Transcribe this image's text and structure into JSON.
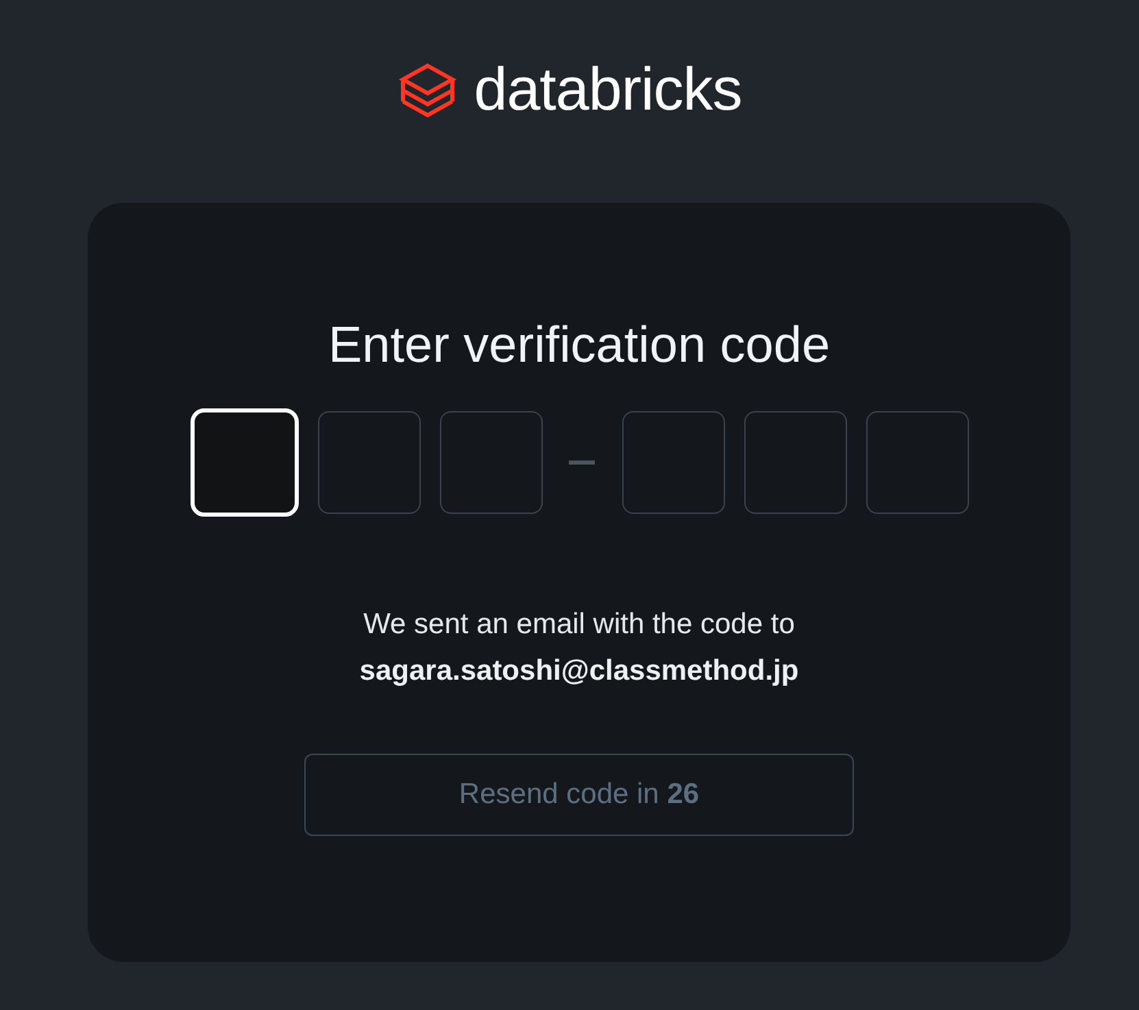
{
  "logo": {
    "text": "databricks"
  },
  "card": {
    "title": "Enter verification code",
    "code_boxes": [
      {
        "kind": "digit",
        "focused": true
      },
      {
        "kind": "digit",
        "focused": false
      },
      {
        "kind": "digit",
        "focused": false
      },
      {
        "kind": "separator"
      },
      {
        "kind": "digit",
        "focused": false
      },
      {
        "kind": "digit",
        "focused": false
      },
      {
        "kind": "digit",
        "focused": false
      }
    ],
    "message": "We sent an email with the code to",
    "email": "sagara.satoshi@classmethod.jp",
    "resend_button": {
      "text": "Resend code in **26**",
      "disabled": true
    }
  }
}
